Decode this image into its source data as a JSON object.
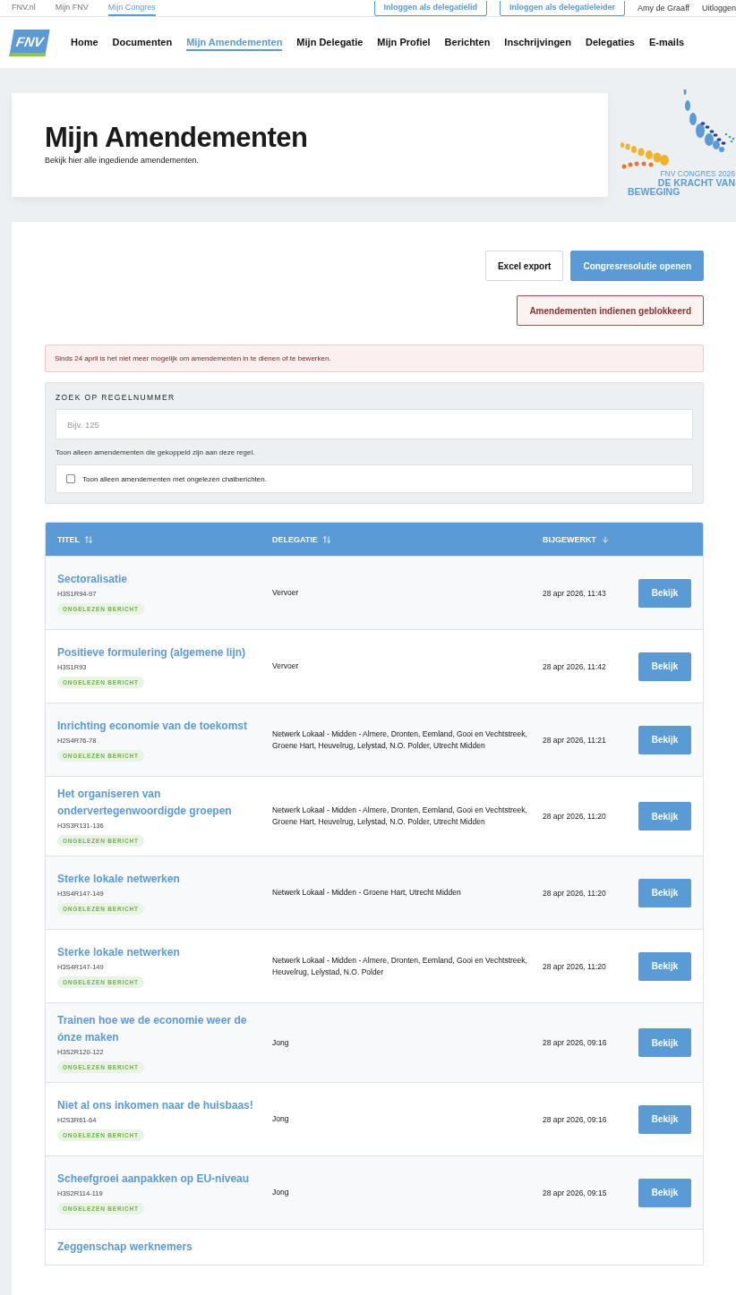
{
  "top_bar": {
    "links": [
      {
        "label": "FNV.nl",
        "selected": false
      },
      {
        "label": "Mijn FNV",
        "selected": false
      },
      {
        "label": "Mijn Congres",
        "selected": true
      }
    ],
    "buttons": [
      "Inloggen als delegatielid",
      "Inloggen als delegatieleider"
    ],
    "user": "Amy de Graaff",
    "logout": "Uitloggen"
  },
  "nav": {
    "logo": "FNV",
    "items": [
      {
        "label": "Home",
        "selected": false
      },
      {
        "label": "Documenten",
        "selected": false
      },
      {
        "label": "Mijn Amendementen",
        "selected": true
      },
      {
        "label": "Mijn Delegatie",
        "selected": false
      },
      {
        "label": "Mijn Profiel",
        "selected": false
      },
      {
        "label": "Berichten",
        "selected": false
      },
      {
        "label": "Inschrijvingen",
        "selected": false
      },
      {
        "label": "Delegaties",
        "selected": false
      },
      {
        "label": "E-mails",
        "selected": false
      }
    ]
  },
  "header": {
    "title": "Mijn Amendementen",
    "subtitle": "Bekijk hier alle ingediende amendementen.",
    "congress_logo": {
      "line_1": "FNV CONGRES 2026",
      "line_2": "DE KRACHT VAN",
      "line_3": "BEWEGING"
    }
  },
  "actions": [
    {
      "label": "Excel export",
      "kind": "secondary"
    },
    {
      "label": "Congresresolutie openen",
      "kind": "primary"
    },
    {
      "label": "Amendementen indienen geblokkeerd",
      "kind": "blocked"
    }
  ],
  "alert": "Sinds 24 april is het niet meer mogelijk om amendementen in te dienen of te bewerken.",
  "filter": {
    "label": "ZOEK OP REGELNUMMER",
    "placeholder": "Bijv. 125",
    "hint": "Toon alleen amendementen die gekoppeld zijn aan deze regel.",
    "checkbox": {
      "label": "Toon alleen amendementen met ongelezen chatberichten.",
      "checked": false
    }
  },
  "table": {
    "columns": [
      {
        "label": "TITEL",
        "kind": "sortable"
      },
      {
        "label": "DELEGATIE",
        "kind": "sortable"
      },
      {
        "label": "BIJGEWERKT",
        "kind": "sorted"
      }
    ],
    "rows": [
      {
        "title": "Sectoralisatie",
        "code": "H3S1R94-97",
        "badge": "ONGELEZEN BERICHT",
        "delegation": "Vervoer",
        "updated": "28 apr 2026, 11:43",
        "action": "Bekijk"
      },
      {
        "title": "Positieve formulering (algemene lijn)",
        "code": "H3S1R93",
        "badge": "ONGELEZEN BERICHT",
        "delegation": "Vervoer",
        "updated": "28 apr 2026, 11:42",
        "action": "Bekijk"
      },
      {
        "title": "Inrichting economie van de toekomst",
        "code": "H2S4R76-78",
        "badge": "ONGELEZEN BERICHT",
        "delegation": "Netwerk Lokaal - Midden - Almere, Dronten, Eemland, Gooi en Vechtstreek, Groene Hart, Heuvelrug, Lelystad, N.O. Polder, Utrecht Midden",
        "updated": "28 apr 2026, 11:21",
        "action": "Bekijk"
      },
      {
        "title": "Het organiseren van ondervertegenwoordigde groepen",
        "code": "H3S3R131-136",
        "badge": "ONGELEZEN BERICHT",
        "delegation": "Netwerk Lokaal - Midden - Almere, Dronten, Eemland, Gooi en Vechtstreek, Groene Hart, Heuvelrug, Lelystad, N.O. Polder, Utrecht Midden",
        "updated": "28 apr 2026, 11:20",
        "action": "Bekijk"
      },
      {
        "title": "Sterke lokale netwerken",
        "code": "H3S4R147-149",
        "badge": "ONGELEZEN BERICHT",
        "delegation": "Netwerk Lokaal - Midden - Groene Hart, Utrecht Midden",
        "updated": "28 apr 2026, 11:20",
        "action": "Bekijk"
      },
      {
        "title": "Sterke lokale netwerken",
        "code": "H3S4R147-149",
        "badge": "ONGELEZEN BERICHT",
        "delegation": "Netwerk Lokaal - Midden - Almere, Dronten, Eemland, Gooi en Vechtstreek, Heuvelrug, Lelystad, N.O. Polder",
        "updated": "28 apr 2026, 11:20",
        "action": "Bekijk"
      },
      {
        "title": "Trainen hoe we de economie weer de ónze maken",
        "code": "H3S2R120-122",
        "badge": "ONGELEZEN BERICHT",
        "delegation": "Jong",
        "updated": "28 apr 2026, 09:16",
        "action": "Bekijk"
      },
      {
        "title": "Niet al ons inkomen naar de huisbaas!",
        "code": "H2S3R61-64",
        "badge": "ONGELEZEN BERICHT",
        "delegation": "Jong",
        "updated": "28 apr 2026, 09:16",
        "action": "Bekijk"
      },
      {
        "title": "Scheefgroei aanpakken op EU-niveau",
        "code": "H3S2R114-119",
        "badge": "ONGELEZEN BERICHT",
        "delegation": "Jong",
        "updated": "28 apr 2026, 09:15",
        "action": "Bekijk"
      },
      {
        "title": "Zeggenschap werknemers"
      }
    ]
  }
}
